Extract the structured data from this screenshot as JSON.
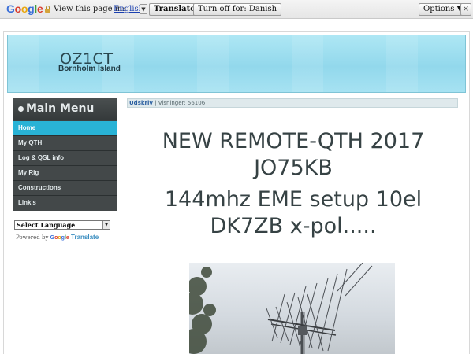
{
  "translate_bar": {
    "logo_letters": [
      {
        "ch": "G",
        "color": "#3b6fd8"
      },
      {
        "ch": "o",
        "color": "#d93a2b"
      },
      {
        "ch": "o",
        "color": "#e9a80f"
      },
      {
        "ch": "g",
        "color": "#3b6fd8"
      },
      {
        "ch": "l",
        "color": "#3d9a3d"
      },
      {
        "ch": "e",
        "color": "#d93a2b"
      }
    ],
    "prompt": "View this page in:",
    "language": "English",
    "translate_button": "Translate",
    "turn_off_button": "Turn off for: Danish",
    "options_button": "Options ▼",
    "close_glyph": "×"
  },
  "header": {
    "title": "OZ1CT",
    "subtitle": "Bornholm Island"
  },
  "sidebar": {
    "menu_title": "Main Menu",
    "items": [
      {
        "label": "Home",
        "active": true
      },
      {
        "label": "My QTH",
        "active": false
      },
      {
        "label": "Log & QSL info",
        "active": false
      },
      {
        "label": "My Rig",
        "active": false
      },
      {
        "label": "Constructions",
        "active": false
      },
      {
        "label": "Link's",
        "active": false
      }
    ],
    "language_select": "Select Language",
    "powered_by": "Powered by",
    "google_small": "Google",
    "translate_link": "Translate"
  },
  "content": {
    "print_link": "Udskriv",
    "separator": "|",
    "views": "Visninger: 56106",
    "headings": [
      "NEW REMOTE-QTH 2017",
      "JO75KB",
      "144mhz EME setup 10el",
      "DK7ZB x-pol....."
    ]
  },
  "colors": {
    "header_bg": "#9fdff0",
    "menu_bg": "#434849",
    "active_item": "#29b3d6"
  }
}
